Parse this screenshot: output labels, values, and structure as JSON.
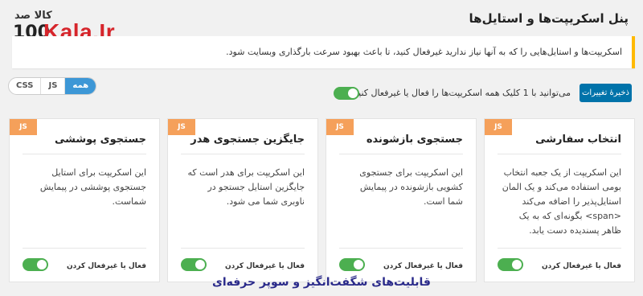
{
  "logo": {
    "top_text": "کالا صد",
    "number_text": "100",
    "brand_text": "Kala.Ir"
  },
  "header": {
    "title": "پنل اسکریپت‌ها و استایل‌ها"
  },
  "notice": {
    "text": "اسکریپت‌ها و استایل‌هایی را که به آنها نیاز ندارید غیرفعال کنید، تا باعث بهبود سرعت بارگذاری وبسایت شود."
  },
  "filter_tabs": [
    {
      "label": "همه",
      "active": true
    },
    {
      "label": "JS",
      "active": false
    },
    {
      "label": "CSS",
      "active": false
    }
  ],
  "toolbar": {
    "save_label": "ذخیرهٔ تغییرات",
    "global_toggle_label": "می‌توانید با 1 کلیک همه اسکریپت‌ها را فعال یا غیرفعال کنید.",
    "global_toggle_on": true
  },
  "cards": [
    {
      "badge": "JS",
      "title": "انتخاب سفارشی",
      "description": "این اسکریپت از یک جعبه انتخاب بومی استفاده می‌کند و یک المان استایل‌پذیر را اضافه می‌کند <span> بگونه‌ای که به یک ظاهر پسندیده دست یابد.",
      "toggle_label": "فعال یا غیرفعال کردن",
      "enabled": true
    },
    {
      "badge": "JS",
      "title": "جستجوی بازشونده",
      "description": "این اسکریپت برای جستجوی کشویی بازشونده در پیمایش شما است.",
      "toggle_label": "فعال یا غیرفعال کردن",
      "enabled": true
    },
    {
      "badge": "JS",
      "title": "جایگزین جستجوی هدر",
      "description": "این اسکریپت برای هدر است که جایگزین استایل جستجو در ناوبری شما می شود.",
      "toggle_label": "فعال یا غیرفعال کردن",
      "enabled": true
    },
    {
      "badge": "JS",
      "title": "جستجوی پوششی",
      "description": "این اسکریپت برای استایل جستجوی پوششی در پیمایش شماست.",
      "toggle_label": "فعال یا غیرفعال کردن",
      "enabled": true
    }
  ],
  "caption": {
    "text": "قابلیت‌های شگفت‌انگیز و سوپر حرفه‌ای"
  },
  "colors": {
    "accent": "#0073aa",
    "tab_active": "#3d97d6",
    "toggle_on": "#4caf50",
    "badge": "#f5a05a",
    "notice_border": "#ffb900",
    "caption": "#2a2a8a",
    "logo_red": "#d6252b"
  }
}
